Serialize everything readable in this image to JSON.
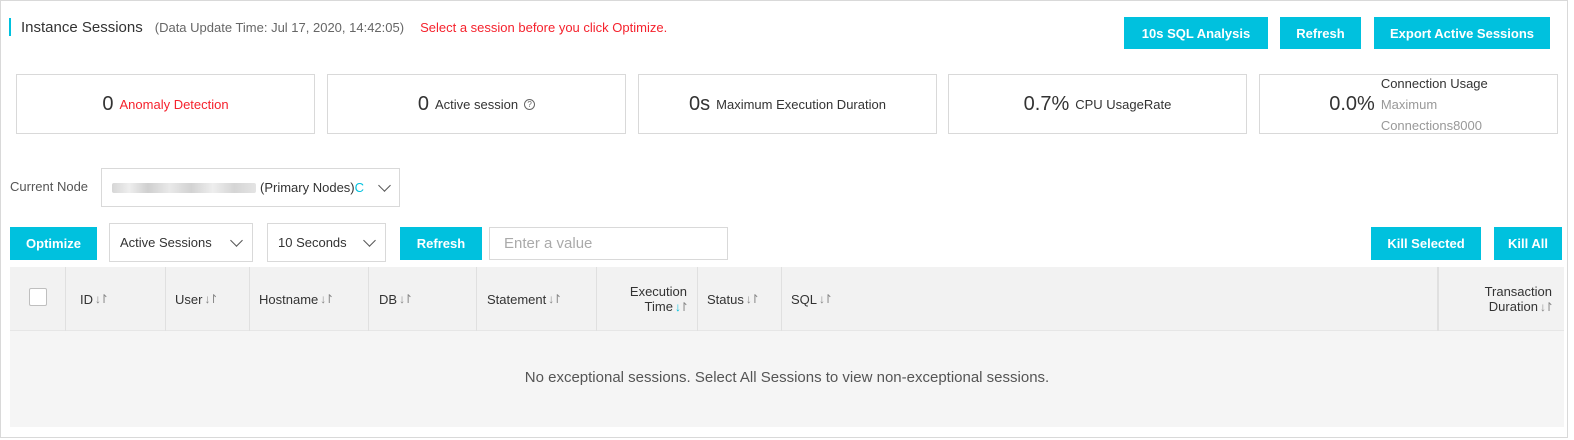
{
  "header": {
    "title": "Instance Sessions",
    "update_time": "(Data Update Time: Jul 17, 2020, 14:42:05)",
    "hint": "Select a session before you click Optimize."
  },
  "top_buttons": {
    "sql_analysis": "10s SQL Analysis",
    "refresh": "Refresh",
    "export": "Export Active Sessions"
  },
  "stats": {
    "anomaly": {
      "value": "0",
      "label": "Anomaly Detection"
    },
    "active": {
      "value": "0",
      "label": "Active session",
      "help": "?"
    },
    "max_exec": {
      "value": "0s",
      "label": "Maximum Execution Duration"
    },
    "cpu": {
      "value": "0.7%",
      "label": "CPU UsageRate"
    },
    "connection": {
      "value": "0.0%",
      "label": "Connection Usage",
      "sub1": "Maximum",
      "sub2": "Connections8000"
    }
  },
  "node": {
    "label": "Current Node",
    "value": "(Primary Nodes)",
    "suffix": "C"
  },
  "toolbar": {
    "optimize": "Optimize",
    "session_type": "Active Sessions",
    "interval": "10 Seconds",
    "refresh": "Refresh",
    "search_placeholder": "Enter a value",
    "kill_selected": "Kill Selected",
    "kill_all": "Kill All"
  },
  "table": {
    "columns": {
      "id": "ID",
      "user": "User",
      "hostname": "Hostname",
      "db": "DB",
      "statement": "Statement",
      "exec_time_1": "Execution",
      "exec_time_2": "Time",
      "status": "Status",
      "sql": "SQL",
      "txn_1": "Transaction",
      "txn_2": "Duration"
    },
    "empty_text": "No exceptional sessions. Select All Sessions to view non-exceptional sessions."
  },
  "colors": {
    "accent": "#00c1de",
    "warning_text": "#f5222d"
  }
}
